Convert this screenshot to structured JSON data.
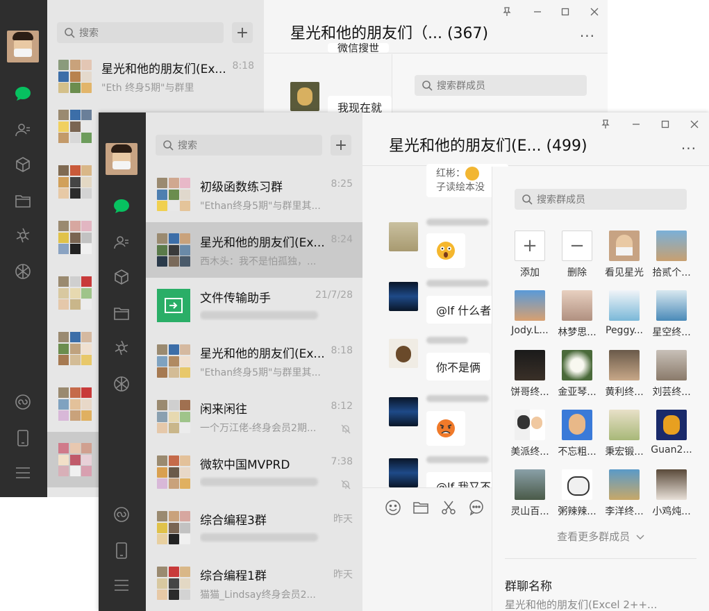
{
  "back_window": {
    "search_placeholder": "搜索",
    "chat_title": "星光和他的朋友们（... (367)",
    "member_search_placeholder": "搜索群成员",
    "top_conversation": {
      "name": "星光和他的朋友们(Ex...",
      "time": "8:18",
      "preview": "\"Eth  终身5期\"与群里"
    },
    "fragments": {
      "line1": "微信搜世",
      "line2": "我现在就"
    }
  },
  "front_window": {
    "search_placeholder": "搜索",
    "chat_title": "星光和他的朋友们(E... (499)",
    "conversations": [
      {
        "name": "初级函数练习群",
        "time": "8:25",
        "preview": "\"Ethan终身5期\"与群里其...",
        "muted": false
      },
      {
        "name": "星光和他的朋友们(Ex...",
        "time": "8:24",
        "preview": "西木头：我不是怕孤独，...",
        "muted": false
      },
      {
        "name": "文件传输助手",
        "time": "21/7/28",
        "preview": "",
        "muted": false
      },
      {
        "name": "星光和他的朋友们(Ex...",
        "time": "8:18",
        "preview": "\"Ethan终身5期\"与群里其...",
        "muted": false
      },
      {
        "name": "闲来闲往",
        "time": "8:12",
        "preview": "一个万江佬-终身会员2期...",
        "muted": true
      },
      {
        "name": "微软中国MVPRD",
        "time": "7:38",
        "preview": "",
        "muted": true
      },
      {
        "name": "综合编程3群",
        "time": "昨天",
        "preview": "",
        "muted": false
      },
      {
        "name": "综合编程1群",
        "time": "昨天",
        "preview": "猫猫_Lindsay终身会员2...",
        "muted": false
      }
    ],
    "messages": [
      {
        "sender": "红彬：",
        "text": "子读绘本没"
      },
      {
        "text": "@lf 什么者"
      },
      {
        "text": "你不是俩"
      },
      {
        "text": "@lf 我又不"
      }
    ],
    "member_panel": {
      "search_placeholder": "搜索群成员",
      "members": [
        "添加",
        "删除",
        "看见星光",
        "拾贰个...",
        "Jody.L...",
        "林梦思...",
        "Peggy...",
        "星空终...",
        "饼哥终...",
        "金亚琴...",
        "黄利终...",
        "刘芸终...",
        "美派终...",
        "不忘粗...",
        "秉宏锻...",
        "Guan2...",
        "灵山百...",
        "粥辣辣...",
        "李洋终...",
        "小鸡炖..."
      ],
      "see_more": "查看更多群成员",
      "group_name_label": "群聊名称",
      "group_name_value": "星光和他的朋友们(Excel 2++..."
    }
  },
  "colors": {
    "accent_green": "#07c160",
    "rail_bg": "#2e2e2e",
    "selected_row": "#cacaca"
  }
}
